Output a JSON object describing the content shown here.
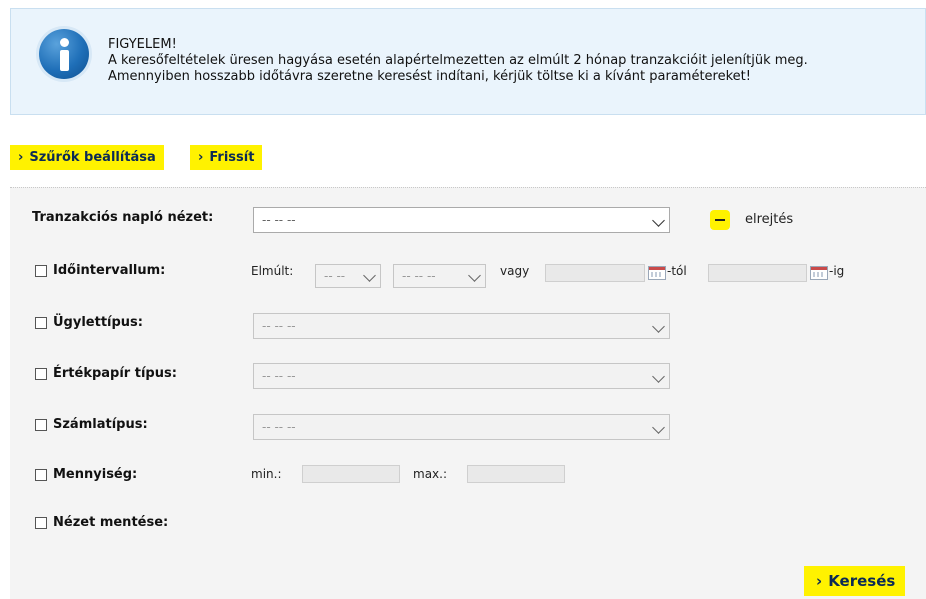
{
  "notice": {
    "icon": "info-icon",
    "title": "FIGYELEM!",
    "line1": "A keresőfeltételek üresen hagyása esetén alapértelmezetten az elmúlt 2 hónap tranzakcióit jelenítjük meg.",
    "line2": "Amennyiben hosszabb időtávra szeretne keresést indítani, kérjük töltse ki a kívánt paramétereket!"
  },
  "toolbar": {
    "filters_label": "Szűrők beállítása",
    "refresh_label": "Frissít",
    "chevron": "›"
  },
  "filters": {
    "view": {
      "label": "Tranzakciós napló nézet:",
      "value": "-- -- --",
      "hide_label": "elrejtés"
    },
    "interval": {
      "label": "Időintervallum:",
      "last_label": "Elmúlt:",
      "last_value": "-- --",
      "unit_value": "-- -- --",
      "or_label": "vagy",
      "from_suffix": "-tól",
      "to_suffix": "-ig"
    },
    "deal_type": {
      "label": "Ügylettípus:",
      "value": "-- -- --"
    },
    "security_type": {
      "label": "Értékpapír típus:",
      "value": "-- -- --"
    },
    "account_type": {
      "label": "Számlatípus:",
      "value": "-- -- --"
    },
    "quantity": {
      "label": "Mennyiség:",
      "min_label": "min.:",
      "max_label": "max.:"
    },
    "save_view": {
      "label": "Nézet mentése:"
    }
  },
  "search_label": "Keresés",
  "colors": {
    "accent": "#fff200",
    "notice_bg": "#eaf4fc",
    "panel_bg": "#f4f4f4",
    "button_text": "#0b2a55"
  }
}
